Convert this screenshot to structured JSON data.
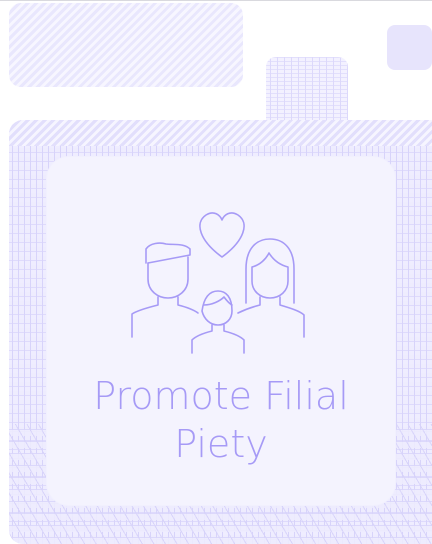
{
  "card": {
    "title": "Promote Filial Piety",
    "icon": "family-heart-icon",
    "accent_color": "#a69af6",
    "card_background": "#f4f3fe",
    "pattern_color": "#e2dffc"
  }
}
